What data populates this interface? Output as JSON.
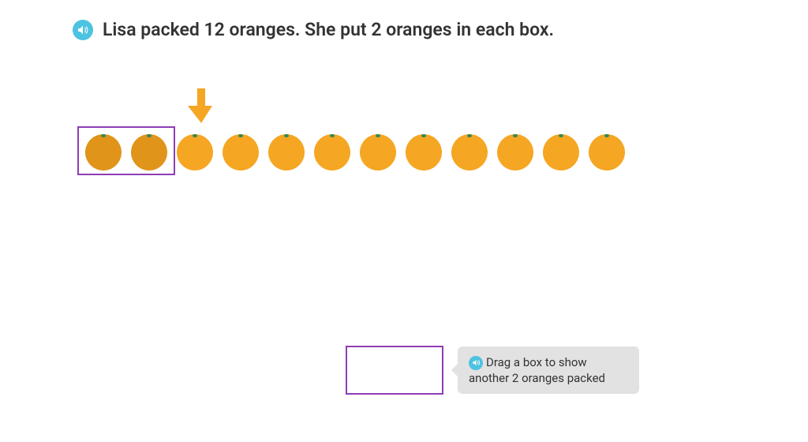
{
  "prompt": "Lisa packed 12 oranges. She put 2 oranges in each box.",
  "hint": "Drag a box to show another 2 oranges packed",
  "oranges": {
    "total": 12,
    "packed": 2,
    "per_box": 2
  },
  "colors": {
    "orange_fill": "#F5A623",
    "orange_packed": "#E0941A",
    "box_border": "#8e3db5",
    "arrow": "#F5A623",
    "audio_bg": "#4cc3e0",
    "hint_bg": "#e2e2e2"
  }
}
